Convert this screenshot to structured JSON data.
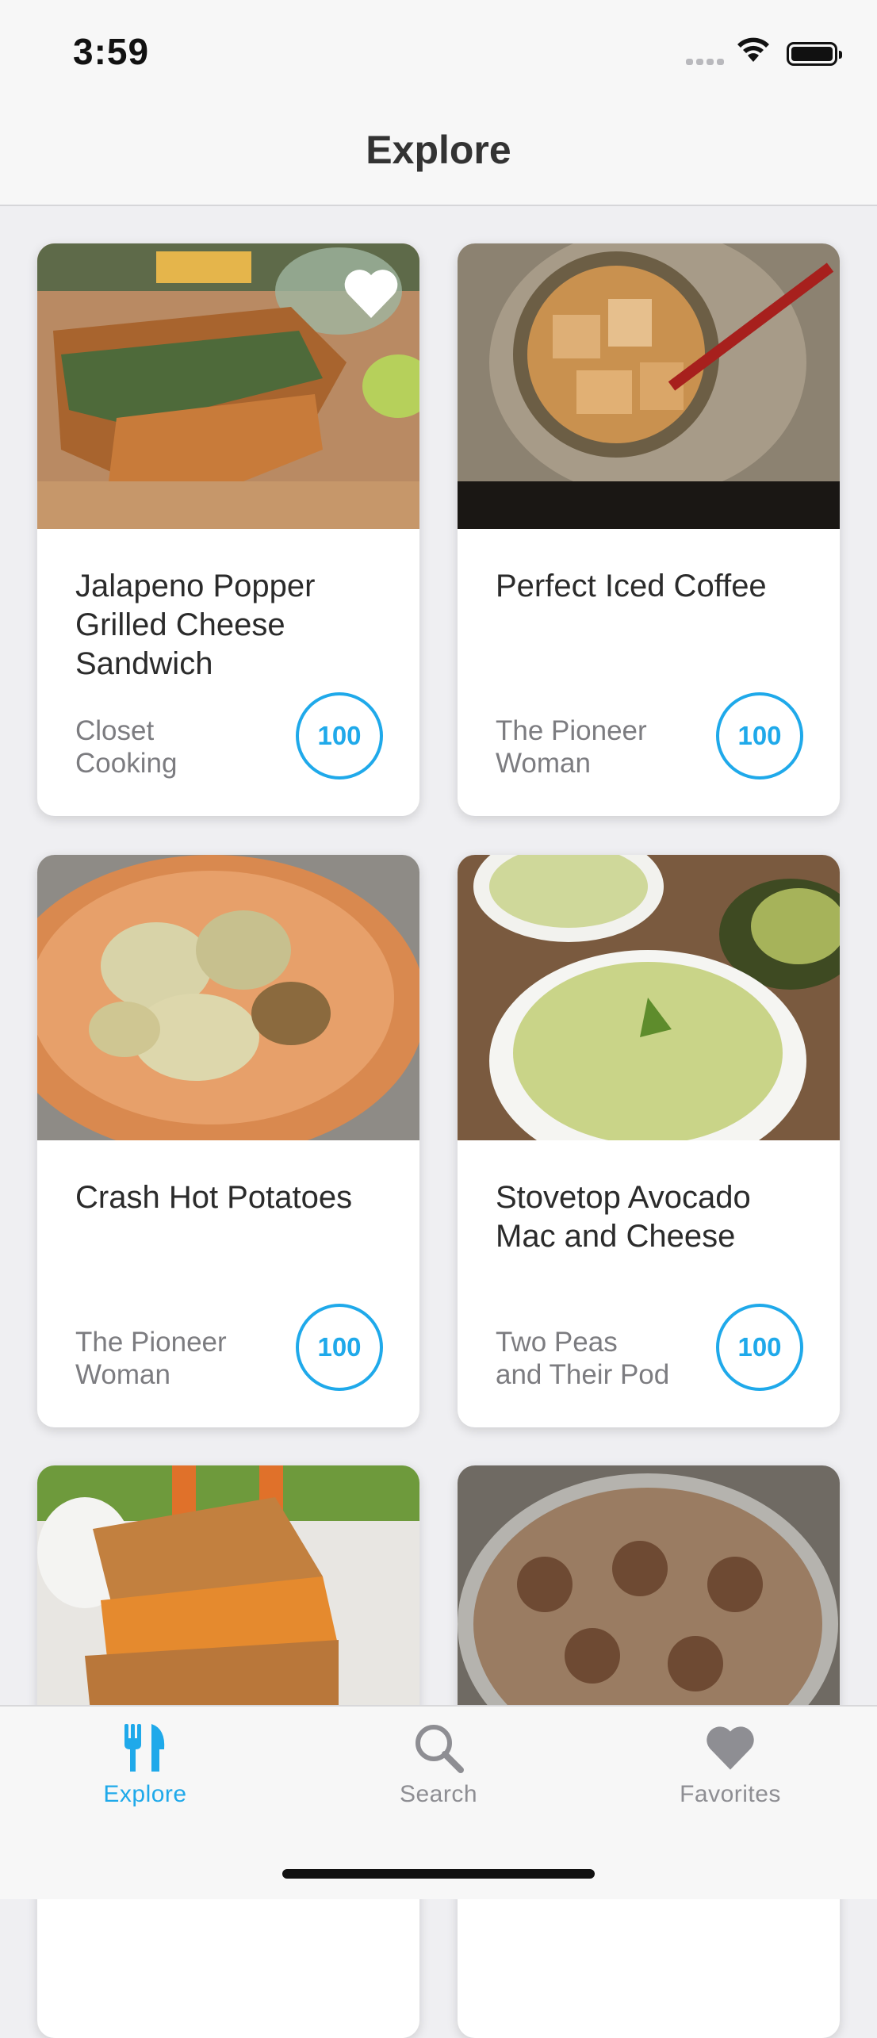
{
  "status_bar": {
    "time": "3:59"
  },
  "nav": {
    "title": "Explore"
  },
  "colors": {
    "accent": "#1fa9ea",
    "inactive": "#8e8e93"
  },
  "recipes": [
    {
      "title": "Jalapeno Popper Grilled Cheese Sandwich",
      "source": "Closet Cooking",
      "score": "100",
      "favorite": true
    },
    {
      "title": "Perfect Iced Coffee",
      "source": "The Pioneer Woman",
      "score": "100",
      "favorite": false
    },
    {
      "title": "Crash Hot Potatoes",
      "source": "The Pioneer Woman",
      "score": "100",
      "favorite": false
    },
    {
      "title": "Stovetop Avocado Mac and Cheese",
      "source": "Two Peas and Their Pod",
      "score": "100",
      "favorite": false
    },
    {
      "title": "",
      "source": "",
      "score": "",
      "favorite": false
    },
    {
      "title": "",
      "source": "",
      "score": "",
      "favorite": false
    }
  ],
  "tabs": [
    {
      "label": "Explore",
      "icon": "fork-knife-icon",
      "active": true
    },
    {
      "label": "Search",
      "icon": "magnifier-icon",
      "active": false
    },
    {
      "label": "Favorites",
      "icon": "heart-icon",
      "active": false
    }
  ]
}
